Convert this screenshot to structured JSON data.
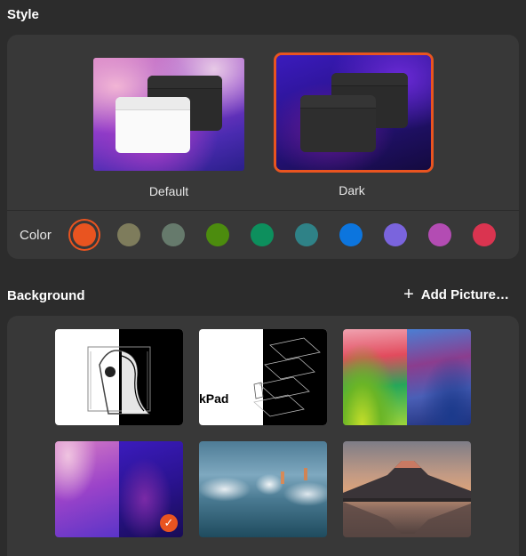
{
  "style": {
    "title": "Style",
    "themes": [
      {
        "label": "Default",
        "selected": false
      },
      {
        "label": "Dark",
        "selected": true
      }
    ],
    "color_label": "Color",
    "accent_colors": [
      "#e95420",
      "#7e7c5c",
      "#667a6c",
      "#4c8c0e",
      "#0d8f5d",
      "#2f8287",
      "#0c75de",
      "#7a64dd",
      "#b34cb3",
      "#da3450"
    ],
    "selected_accent": "#e95420"
  },
  "background": {
    "title": "Background",
    "add_picture_label": "Add Picture…",
    "wallpapers": [
      {
        "name": "mono-portrait",
        "selected": false
      },
      {
        "name": "laptop-exploded",
        "selected": false
      },
      {
        "name": "sonoma-waves",
        "selected": false
      },
      {
        "name": "monterey-purple",
        "selected": true
      },
      {
        "name": "sky-reflection",
        "selected": false
      },
      {
        "name": "mount-fuji",
        "selected": false
      }
    ],
    "partial_text": "kPad"
  },
  "icons": {
    "plus": "plus-icon",
    "check": "check-icon"
  }
}
